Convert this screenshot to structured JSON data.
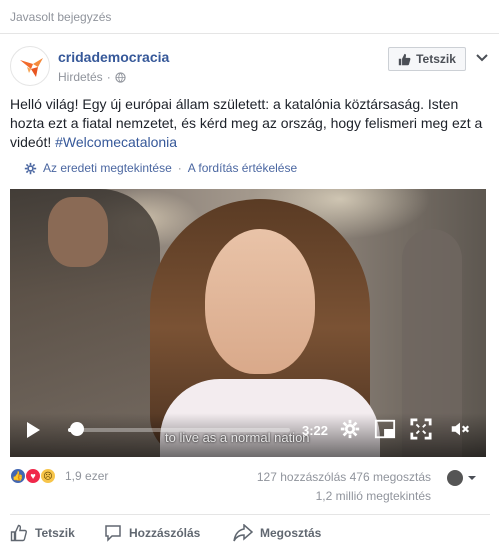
{
  "header": {
    "suggested_label": "Javasolt bejegyzés"
  },
  "post": {
    "page_name": "cridademocracia",
    "sponsored_label": "Hirdetés",
    "like_page_label": "Tetszik",
    "text": "Helló világ! Egy új európai állam született: a katalónia köztársaság. Isten hozta ezt a fiatal nemzetet, és kérd meg az ország, hogy felismeri meg ezt a videót!",
    "hashtag": "#Welcomecatalonia",
    "see_original": "Az eredeti megtekintése",
    "separator": "·",
    "rate_translation": "A fordítás értékelése"
  },
  "video": {
    "time": "3:22",
    "caption": "to live as a normal nation",
    "progress_fraction": 0.05
  },
  "engagement": {
    "reaction_count": "1,9 ezer",
    "comments": "127 hozzászólás",
    "shares": "476 megosztás",
    "views": "1,2 millió megtekintés"
  },
  "actions": {
    "like": "Tetszik",
    "comment": "Hozzászólás",
    "share": "Megosztás"
  },
  "colors": {
    "link": "#365899",
    "secondary_text": "#90949c",
    "brand_orange": "#f26a2b"
  },
  "icons": [
    "logo-icon",
    "globe-icon",
    "thumb-up-icon",
    "chevron-down-icon",
    "gear-icon",
    "play-icon",
    "settings-icon",
    "theater-mode-icon",
    "fullscreen-icon",
    "mute-icon",
    "comment-icon",
    "share-icon"
  ]
}
